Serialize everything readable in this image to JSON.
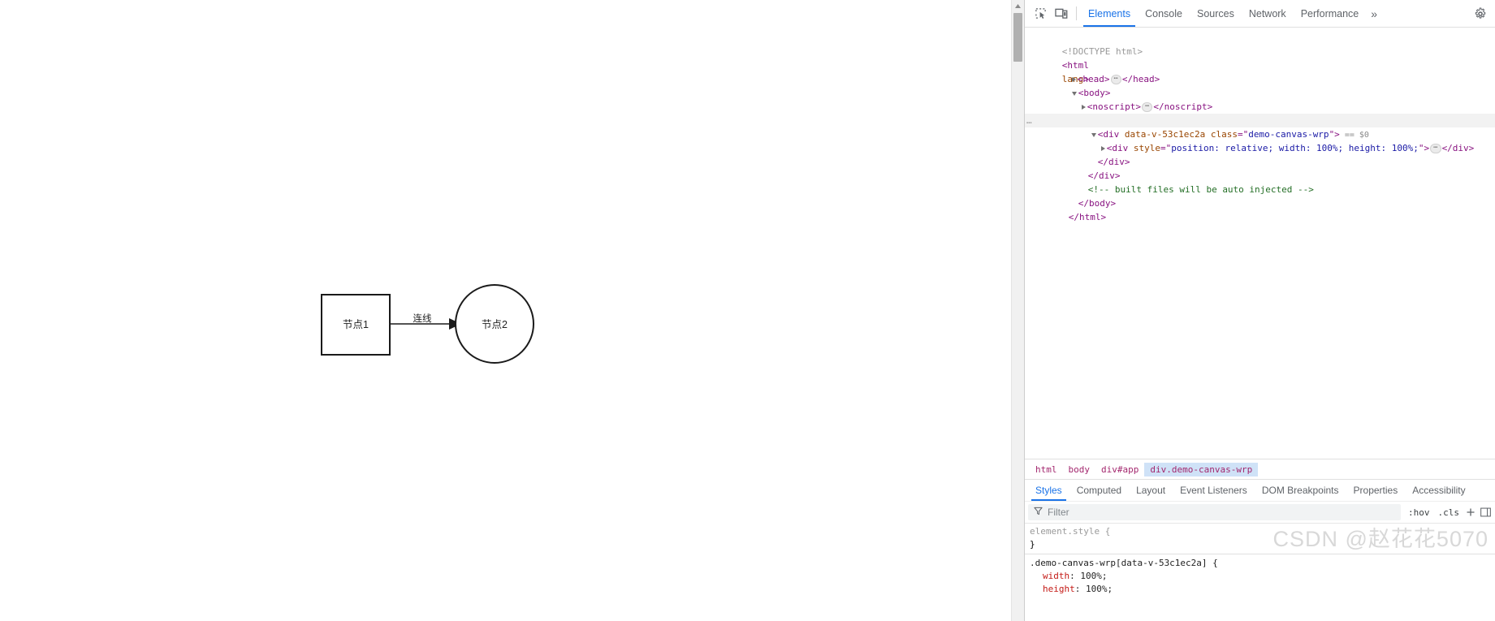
{
  "viewport": {
    "diagram": {
      "node1": {
        "label": "节点1",
        "shape": "rect"
      },
      "node2": {
        "label": "节点2",
        "shape": "circle"
      },
      "edge": {
        "label": "连线"
      },
      "stroke_color": "#1a1a1a"
    },
    "scrollbar": {
      "present": true
    }
  },
  "devtools": {
    "toolbar": {
      "inspect_icon": "inspect-element-icon",
      "device_icon": "device-toolbar-icon",
      "more_tabs_label": "»",
      "settings_icon": "gear-icon",
      "tabs": [
        {
          "label": "Elements",
          "active": true
        },
        {
          "label": "Console",
          "active": false
        },
        {
          "label": "Sources",
          "active": false
        },
        {
          "label": "Network",
          "active": false
        },
        {
          "label": "Performance",
          "active": false
        }
      ]
    },
    "dom_tree": [
      {
        "indent": 0,
        "type": "doctype",
        "text": "<!DOCTYPE html>"
      },
      {
        "indent": 0,
        "type": "open_tag",
        "tag": "html",
        "attrs": [
          {
            "name": "lang",
            "value": null
          }
        ]
      },
      {
        "indent": 1,
        "type": "collapsed",
        "tag": "head",
        "twisty": "closed"
      },
      {
        "indent": 1,
        "type": "open_tag",
        "tag": "body",
        "twisty": "open"
      },
      {
        "indent": 2,
        "type": "collapsed",
        "tag": "noscript",
        "twisty": "closed"
      },
      {
        "indent": 2,
        "type": "open_tag",
        "tag": "div",
        "twisty": "open",
        "attrs": [
          {
            "name": "id",
            "value": "app"
          }
        ]
      },
      {
        "indent": 3,
        "type": "open_tag",
        "tag": "div",
        "twisty": "open",
        "selected": true,
        "gutter": "…",
        "attrs": [
          {
            "name": "data-v-53c1ec2a",
            "value": null
          },
          {
            "name": "class",
            "value": "demo-canvas-wrp"
          }
        ],
        "badges": [
          "== $0"
        ]
      },
      {
        "indent": 4,
        "type": "collapsed",
        "tag": "div",
        "twisty": "closed",
        "attrs": [
          {
            "name": "style",
            "value": "position: relative; width: 100%; height: 100%;"
          }
        ]
      },
      {
        "indent": 3,
        "type": "close_tag",
        "tag": "div"
      },
      {
        "indent": 2,
        "type": "close_tag",
        "tag": "div"
      },
      {
        "indent": 2,
        "type": "comment",
        "text": "<!-- built files will be auto injected -->"
      },
      {
        "indent": 1,
        "type": "close_tag",
        "tag": "body"
      },
      {
        "indent": 0,
        "type": "close_tag",
        "tag": "html"
      }
    ],
    "breadcrumb": [
      {
        "label": "html",
        "active": false
      },
      {
        "label": "body",
        "active": false
      },
      {
        "label": "div#app",
        "active": false
      },
      {
        "label": "div.demo-canvas-wrp",
        "active": true
      }
    ],
    "sidebar_tabs": [
      {
        "label": "Styles",
        "active": true
      },
      {
        "label": "Computed",
        "active": false
      },
      {
        "label": "Layout",
        "active": false
      },
      {
        "label": "Event Listeners",
        "active": false
      },
      {
        "label": "DOM Breakpoints",
        "active": false
      },
      {
        "label": "Properties",
        "active": false
      },
      {
        "label": "Accessibility",
        "active": false
      }
    ],
    "filter_row": {
      "filter_icon": "filter-funnel-icon",
      "placeholder": "Filter",
      "hov_label": ":hov",
      "cls_label": ".cls",
      "new_rule_icon": "plus-icon",
      "toggle_icon": "computed-sidebar-icon"
    },
    "styles": {
      "rules": [
        {
          "selector": "element.style",
          "selector_style": "grey",
          "open_brace": "{",
          "close_brace": "}",
          "declarations": []
        },
        {
          "selector": ".demo-canvas-wrp[data-v-53c1ec2a]",
          "selector_style": "dark",
          "open_brace": "{",
          "close_brace": "",
          "declarations": [
            {
              "property": "width",
              "value": "100%;"
            },
            {
              "property": "height",
              "value": "100%;"
            }
          ]
        }
      ]
    }
  },
  "watermark": {
    "text": "CSDN @赵花花5070"
  },
  "colors": {
    "accent_blue": "#1a73e8",
    "tag_purple": "#881280",
    "attr_orange": "#994500",
    "value_blue": "#1a1aa6",
    "comment_green": "#236e25",
    "prop_red": "#c41a16",
    "breadcrumb_pink": "#a3276e",
    "selected_bg": "#cfe2f7"
  }
}
